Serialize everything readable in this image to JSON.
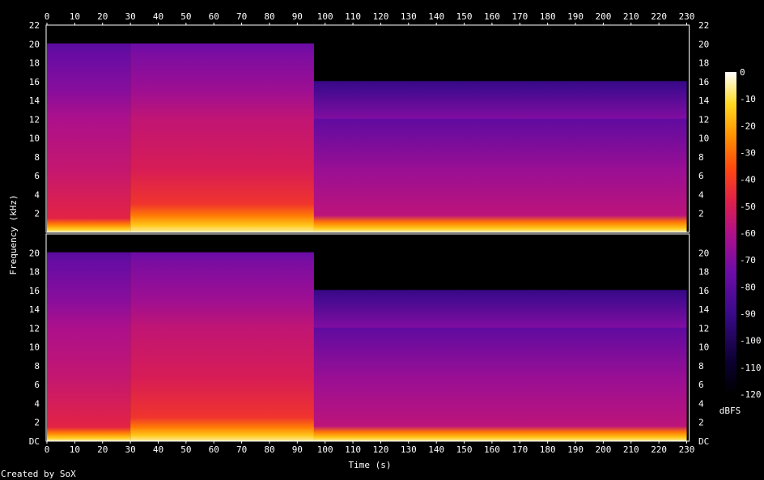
{
  "chart_data": {
    "type": "heatmap",
    "xlabel": "Time (s)",
    "ylabel": "Frequency (kHz)",
    "colorbar_label": "dBFS",
    "x_ticks": [
      "0",
      "10",
      "20",
      "30",
      "40",
      "50",
      "60",
      "70",
      "80",
      "90",
      "100",
      "110",
      "120",
      "130",
      "140",
      "150",
      "160",
      "170",
      "180",
      "190",
      "200",
      "210",
      "220",
      "230"
    ],
    "xlim": [
      0,
      232
    ],
    "y_ticks_top": [
      "2",
      "4",
      "6",
      "8",
      "10",
      "12",
      "14",
      "16",
      "18",
      "20",
      "22"
    ],
    "y_ticks_bottom": [
      "DC",
      "2",
      "4",
      "6",
      "8",
      "10",
      "12",
      "14",
      "16",
      "18",
      "20"
    ],
    "ylim": [
      0,
      22
    ],
    "colorbar_ticks": [
      "0",
      "-10",
      "-20",
      "-30",
      "-40",
      "-50",
      "-60",
      "-70",
      "-80",
      "-90",
      "-100",
      "-110",
      "-120"
    ],
    "colorbar_range": [
      -120,
      0
    ],
    "colors": {
      "background": "#000000",
      "text": "#ffffff"
    },
    "channels": [
      {
        "segments": [
          {
            "t_start": 0,
            "t_end": 30,
            "cutoff_khz": 20,
            "bass_khz": 1.5,
            "level_db": -55
          },
          {
            "t_start": 30,
            "t_end": 96,
            "cutoff_khz": 20,
            "bass_khz": 3,
            "level_db": -50
          },
          {
            "t_start": 96,
            "t_end": 230,
            "cutoff_khz": 16,
            "bass_khz": 1.8,
            "level_db": -65
          }
        ]
      },
      {
        "segments": [
          {
            "t_start": 0,
            "t_end": 30,
            "cutoff_khz": 20,
            "bass_khz": 1.5,
            "level_db": -55
          },
          {
            "t_start": 30,
            "t_end": 96,
            "cutoff_khz": 20,
            "bass_khz": 2.5,
            "level_db": -50
          },
          {
            "t_start": 96,
            "t_end": 230,
            "cutoff_khz": 16,
            "bass_khz": 1.6,
            "level_db": -65
          }
        ]
      }
    ]
  },
  "footer": {
    "credit": "Created by SoX"
  }
}
